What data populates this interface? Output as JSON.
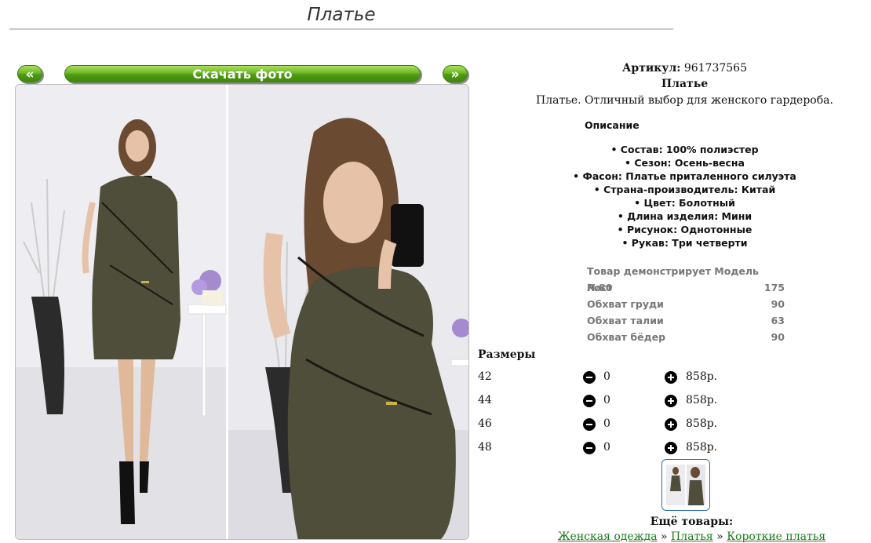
{
  "page": {
    "title": "Платье"
  },
  "gallery": {
    "prev_label": "«",
    "download_label": "Скачать фото",
    "next_label": "»"
  },
  "product": {
    "sku_label": "Артикул:",
    "sku_value": "961737565",
    "name": "Платье",
    "description": "Платье. Отличный выбор для женского гардероба.",
    "desc_heading": "Описание",
    "specs": [
      "• Состав: 100% полиэстер",
      "• Сезон: Осень-весна",
      "• Фасон: Платье приталенного силуэта",
      "• Страна-производитель: Китай",
      "• Цвет: Болотный",
      "• Длина изделия: Мини",
      "• Рисунок: Однотонные",
      "• Рукав: Три четверти"
    ]
  },
  "model": {
    "heading": "Товар демонстрирует Модель №80",
    "rows": [
      {
        "label": "Рост",
        "value": "175"
      },
      {
        "label": "Обхват груди",
        "value": "90"
      },
      {
        "label": "Обхват талии",
        "value": "63"
      },
      {
        "label": "Обхват бёдер",
        "value": "90"
      }
    ]
  },
  "sizes": {
    "heading": "Размеры",
    "rows": [
      {
        "size": "42",
        "qty": "0",
        "price": "858р."
      },
      {
        "size": "44",
        "qty": "0",
        "price": "858р."
      },
      {
        "size": "46",
        "qty": "0",
        "price": "858р."
      },
      {
        "size": "48",
        "qty": "0",
        "price": "858р."
      }
    ]
  },
  "more": {
    "heading": "Ещё товары:",
    "crumbs": [
      "Женская одежда",
      "Платья",
      "Короткие платья"
    ],
    "separator": "»"
  },
  "colors": {
    "dress": "#4f4e3a",
    "button_green": "#5aa51c",
    "link_green": "#1a7a1a"
  }
}
